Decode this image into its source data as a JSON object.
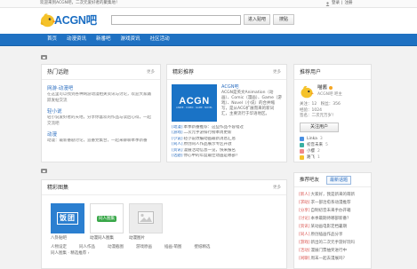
{
  "top_bar": {
    "welcome": "欢迎来到ACGN吧，二次元爱好者的聚集地！",
    "login": "登录",
    "separator": "|",
    "register": "注册"
  },
  "header": {
    "logo_text": "ACGN吧",
    "search": {
      "value": "",
      "placeholder": ""
    },
    "enter_button": "进入贴吧",
    "search_button": "搜贴"
  },
  "nav": {
    "items": [
      "首页",
      "动漫资讯",
      "新番吧",
      "游戏资讯",
      "社区活动"
    ]
  },
  "hot_topics": {
    "title": "热门话题",
    "more": "更多",
    "items": [
      {
        "title": "网游·动漫吧",
        "desc": "在这里可以找到各种网游动漫相关资讯与讨论，欢迎大家踊跃发帖交流"
      },
      {
        "title": "轻小说",
        "desc": "轻小说爱好者的天地，分享你喜欢的作品与读后心得，一起交流吧"
      },
      {
        "title": "动漫",
        "desc": "动漫：最新番剧讨论，追番党集合，一起来聊聊本季新番"
      }
    ]
  },
  "featured": {
    "title": "精彩推荐",
    "more": "更多",
    "image_title": "ACGN",
    "image_subtitle": "ANIME · COMIC · GAME · NOVEL",
    "intro_title": "ACGN吧",
    "intro_text": "ACGN是英文Animation（动画）、Comic（漫画）、Game（游戏）、Novel（小说）的合并缩写，是从ACG扩展而来的新词汇，主要流行于华语地区。",
    "items": [
      {
        "tag": "[动漫]",
        "text": "本季新番推荐：这些作品不容错过"
      },
      {
        "tag": "[游戏]",
        "text": "二次元手游排行榜本周更新"
      },
      {
        "tag": "[小说]",
        "text": "轻小说改编动画最新消息汇总"
      },
      {
        "tag": "[同人]",
        "text": "原创同人作品展示专区开放"
      },
      {
        "tag": "[资讯]",
        "text": "漫展活动信息一览，快来报名"
      },
      {
        "tag": "[话题]",
        "text": "你心中的年度最佳动画是哪部？"
      }
    ]
  },
  "recommended_users": {
    "title": "推荐用户",
    "user": {
      "name": "喵酱",
      "role": "ACGN吧 吧主",
      "stats": [
        "关注：12　粉丝：356",
        "经验：1024",
        "签名：二次元万岁！"
      ]
    },
    "follow_button": "关注用户",
    "list": [
      {
        "name": "Linka",
        "count": "3"
      },
      {
        "name": "初音未来",
        "count": "5"
      },
      {
        "name": "小樱",
        "count": "2"
      },
      {
        "name": "路飞",
        "count": "1"
      }
    ]
  },
  "gallery": {
    "title": "精彩图集",
    "more": "更多",
    "thumbs": [
      {
        "label": "饭团",
        "caption": "八卦贴吧"
      },
      {
        "label": "同人图集",
        "caption": "动漫同人图集"
      },
      {
        "label": "",
        "caption": "动漫图片"
      }
    ],
    "tags": [
      "人物设定",
      "同人作品",
      "动漫截图",
      "游戏原画",
      "插画·萌图",
      "壁纸精选"
    ],
    "more_row": "同人图集 · 精选推荐 ›"
  },
  "activity": {
    "tabs": [
      "推荐吧友",
      "最新话题"
    ],
    "items": [
      {
        "tag": "[新人]",
        "text": "大家好，我是新来的萌新"
      },
      {
        "tag": "[求助]",
        "text": "求一部治愈系动漫推荐"
      },
      {
        "tag": "[分享]",
        "text": "自制初音未来手办开箱"
      },
      {
        "tag": "[讨论]",
        "text": "本季最期待哪部新番？"
      },
      {
        "tag": "[资讯]",
        "text": "某动画电影定档暑期"
      },
      {
        "tag": "[同人]",
        "text": "原创插画作品分享"
      },
      {
        "tag": "[游戏]",
        "text": "新出的二次元手游好玩吗"
      },
      {
        "tag": "[活动]",
        "text": "漫展门票抽奖进行中"
      },
      {
        "tag": "[闲聊]",
        "text": "周末一起去漫展吗？"
      }
    ]
  },
  "colors": {
    "brand_blue": "#1f71c2",
    "link_blue": "#2d6fc0",
    "logo_blue": "#1a6dc2",
    "logo_yellow": "#f5c22a",
    "accent_red": "#d9534f",
    "tag_green": "#3aa84a"
  },
  "icons": {
    "logo": "chick-mascot-icon",
    "account": "user-icon",
    "section": "section-marker-icon",
    "placeholder": "image-placeholder-icon"
  }
}
